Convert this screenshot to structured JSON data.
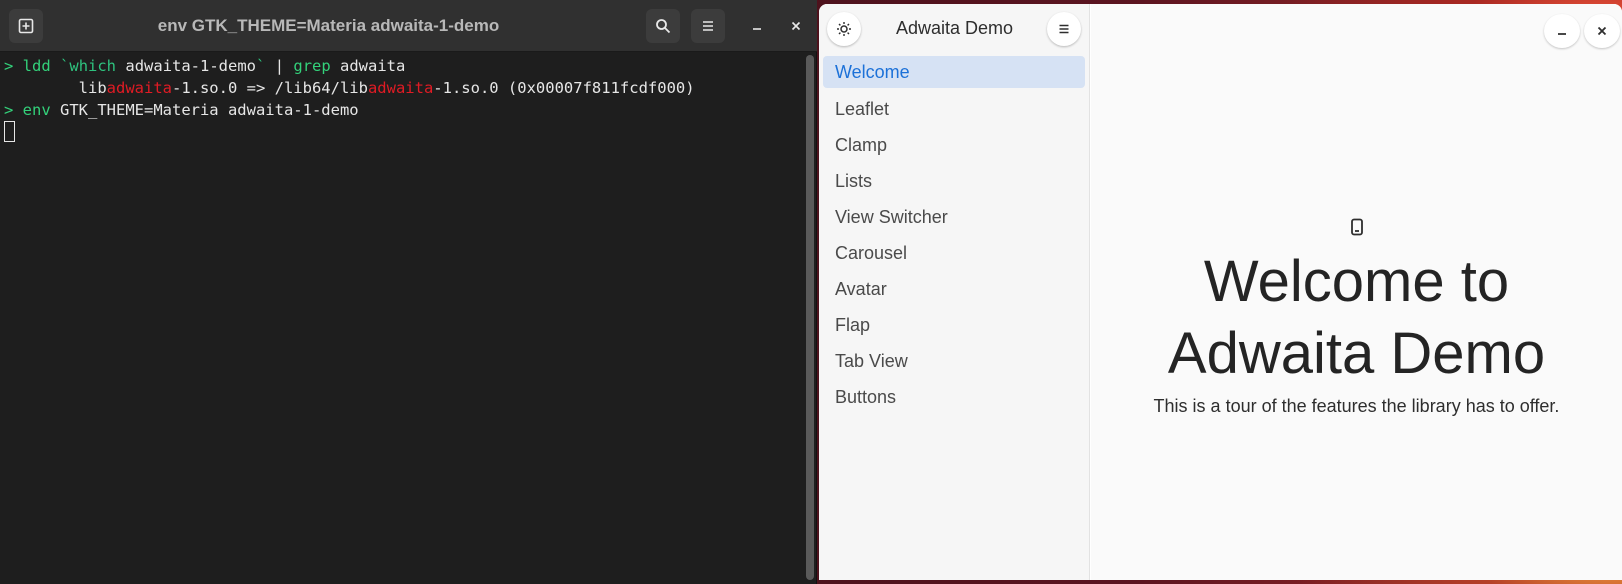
{
  "terminal": {
    "title": "env GTK_THEME=Materia adwaita-1-demo",
    "lines": {
      "l1_prompt": "> ",
      "l1_cmd": "ldd",
      "l1_space": " ",
      "l1_bt_open": "`",
      "l1_which": "which",
      "l1_arg": " adwaita-1-demo",
      "l1_bt_close": "`",
      "l1_pipe": " | ",
      "l1_grep": "grep",
      "l1_grep_arg": " adwaita",
      "l2_indent": "        lib",
      "l2_red1": "adwaita",
      "l2_mid": "-1.so.0 => /lib64/lib",
      "l2_red2": "adwaita",
      "l2_end": "-1.so.0 (0x00007f811fcdf000)",
      "l3_prompt": "> ",
      "l3_cmd": "env",
      "l3_rest": " GTK_THEME=Materia adwaita-1-demo"
    }
  },
  "adwaita": {
    "title": "Adwaita Demo",
    "nav": [
      {
        "label": "Welcome"
      },
      {
        "label": "Leaflet"
      },
      {
        "label": "Clamp"
      },
      {
        "label": "Lists"
      },
      {
        "label": "View Switcher"
      },
      {
        "label": "Carousel"
      },
      {
        "label": "Avatar"
      },
      {
        "label": "Flap"
      },
      {
        "label": "Tab View"
      },
      {
        "label": "Buttons"
      }
    ],
    "welcome_title": "Welcome to Adwaita Demo",
    "welcome_subtitle": "This is a tour of the features the library has to offer."
  },
  "colors": {
    "accent": "#1c71d8",
    "selected_bg": "#d6e2f4",
    "terminal_bg": "#1e1e1e",
    "prompt_green": "#33d17a",
    "match_red": "#e01b24"
  },
  "icons": {
    "new_tab": "new-tab-icon",
    "search": "search-icon",
    "menu": "hamburger-menu-icon",
    "minimize": "minimize-icon",
    "close": "close-icon",
    "theme": "sun-icon",
    "device": "phone-icon"
  }
}
